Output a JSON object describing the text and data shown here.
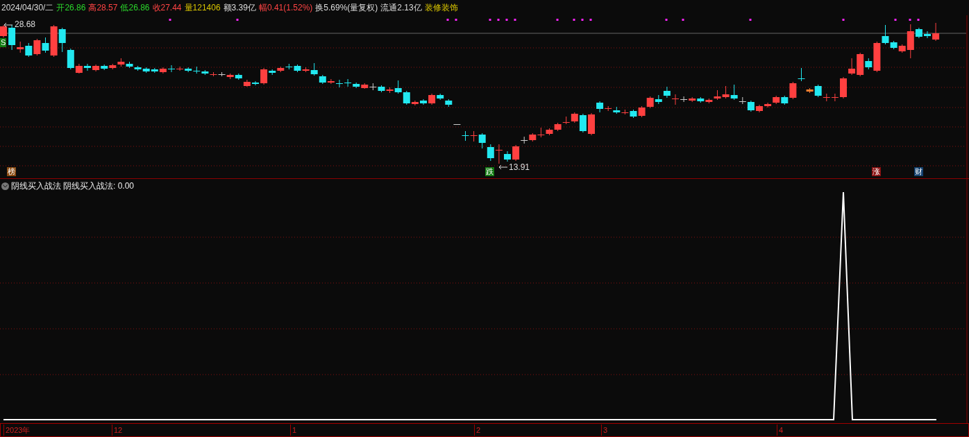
{
  "quote_bar": {
    "date": "2024/04/30/二",
    "fields": [
      {
        "text": "开26.86",
        "color": "#2bd62b"
      },
      {
        "text": "高28.57",
        "color": "#ff4444"
      },
      {
        "text": "低26.86",
        "color": "#2bd62b"
      },
      {
        "text": "收27.44",
        "color": "#ff4444"
      },
      {
        "text": "量121406",
        "color": "#d8c400"
      },
      {
        "text": "额3.39亿",
        "color": "#dddddd"
      },
      {
        "text": "幅0.41(1.52%)",
        "color": "#ff4444"
      },
      {
        "text": "换5.69%(量复权)",
        "color": "#dddddd"
      },
      {
        "text": "流通2.13亿",
        "color": "#dddddd"
      },
      {
        "text": "装修装饰",
        "color": "#d8c400"
      }
    ]
  },
  "price_chart": {
    "high_label": "28.68",
    "low_label": "13.91",
    "badges": [
      {
        "text": "S",
        "color": "#127a12"
      },
      {
        "text": "榜",
        "color": "#8a4a10"
      },
      {
        "text": "跌",
        "color": "#127a12"
      },
      {
        "text": "涨",
        "color": "#8a1010"
      },
      {
        "text": "财",
        "color": "#12406e"
      }
    ]
  },
  "indicator": {
    "name": "阴线买入战法",
    "reading": "阴线买入战法: 0.00"
  },
  "time_axis": {
    "labels": [
      "2023年",
      "12",
      "1",
      "2",
      "3",
      "4"
    ]
  }
}
